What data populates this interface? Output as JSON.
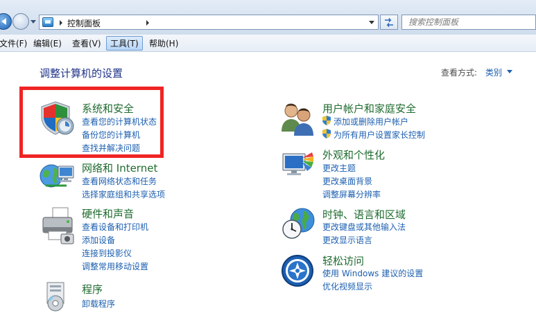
{
  "address_bar": {
    "breadcrumb": "控制面板",
    "search_placeholder": "搜索控制面板"
  },
  "menu": {
    "file": "文件(F)",
    "edit": "编辑(E)",
    "view": "查看(V)",
    "tools": "工具(T)",
    "help": "帮助(H)"
  },
  "header": {
    "title": "调整计算机的设置",
    "view_by_label": "查看方式:",
    "view_by_value": "类别"
  },
  "categories": {
    "system_security": {
      "title": "系统和安全",
      "links": [
        "查看您的计算机状态",
        "备份您的计算机",
        "查找并解决问题"
      ]
    },
    "network": {
      "title": "网络和 Internet",
      "links": [
        "查看网络状态和任务",
        "选择家庭组和共享选项"
      ]
    },
    "hardware": {
      "title": "硬件和声音",
      "links": [
        "查看设备和打印机",
        "添加设备",
        "连接到投影仪",
        "调整常用移动设置"
      ]
    },
    "programs": {
      "title": "程序",
      "links": [
        "卸载程序"
      ]
    },
    "user_accounts": {
      "title": "用户帐户和家庭安全",
      "links": [
        "添加或删除用户帐户",
        "为所有用户设置家长控制"
      ]
    },
    "appearance": {
      "title": "外观和个性化",
      "links": [
        "更改主题",
        "更改桌面背景",
        "调整屏幕分辨率"
      ]
    },
    "clock_region": {
      "title": "时钟、语言和区域",
      "links": [
        "更改键盘或其他输入法",
        "更改显示语言"
      ]
    },
    "ease_of_access": {
      "title": "轻松访问",
      "links": [
        "使用 Windows 建议的设置",
        "优化视频显示"
      ]
    }
  },
  "colors": {
    "category_title": "#1e6b2e",
    "link": "#1c5fb0",
    "highlight": "#f02424"
  }
}
